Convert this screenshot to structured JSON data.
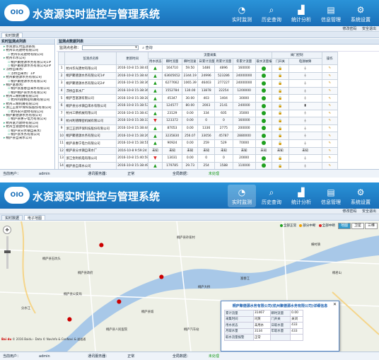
{
  "app": {
    "title": "水资源实时监控与管理系统",
    "logo_text": "OIO",
    "nav": [
      {
        "label": "实时监测",
        "icon": "monitor-icon"
      },
      {
        "label": "历史查询",
        "icon": "search-icon"
      },
      {
        "label": "统计分析",
        "icon": "chart-icon"
      },
      {
        "label": "信息管理",
        "icon": "document-icon"
      },
      {
        "label": "系统设置",
        "icon": "gear-icon"
      }
    ],
    "change_password": "修改密码",
    "logout": "安全退出"
  },
  "panel1": {
    "tabs": [
      "实时数据"
    ],
    "left_title": "实时监测点列表",
    "tree": [
      {
        "level": 1,
        "label": "水资源实时监测系统"
      },
      {
        "level": 1,
        "label": "杭州华光建材有限公司"
      },
      {
        "level": 2,
        "label": "杭州华光建材有限公司"
      },
      {
        "level": 1,
        "label": "杭州市水公司"
      },
      {
        "level": 2,
        "label": "桐庐聚德源水务有限公司1#"
      },
      {
        "level": 2,
        "label": "桐庐聚德源水务有限公司2#"
      },
      {
        "level": 1,
        "label": "浮桥自来水厂"
      },
      {
        "level": 2,
        "label": "浮桥自来水厂1#"
      },
      {
        "level": 1,
        "label": "杭州聚德源水务有限公司"
      },
      {
        "level": 2,
        "label": "桐庐聚德源水务有限公司"
      },
      {
        "level": 1,
        "label": "桐庐富春水厂"
      },
      {
        "level": 2,
        "label": "桐庐县富春自来水有限公司"
      },
      {
        "level": 2,
        "label": "桐庐桐庐县水务有限公司"
      },
      {
        "level": 1,
        "label": "杭州三精机械有限公司"
      },
      {
        "level": 2,
        "label": "杭州利德精密机械有限公司"
      },
      {
        "level": 1,
        "label": "杭州三精机械有限公司"
      },
      {
        "level": 1,
        "label": "浙江正新环保科技股份有限公司"
      },
      {
        "level": 2,
        "label": "杭州永兴建材有限公司"
      },
      {
        "level": 1,
        "label": "桐庐聚德源水务有限公司"
      },
      {
        "level": 2,
        "label": "桐庐县惠宁电力有限公司"
      },
      {
        "level": 1,
        "label": "杭州富力建材有限公司"
      },
      {
        "level": 1,
        "label": "杭州立德建材有限公司"
      },
      {
        "level": 2,
        "label": "桐庐县分水镇自来水厂"
      },
      {
        "level": 2,
        "label": "桐庐县水务有限公司"
      },
      {
        "level": 1,
        "label": "桐庐县自来水公司"
      }
    ],
    "list_title": "监测点数据列表",
    "filter_label": "监测点名称：",
    "query_label": "查询",
    "headers": {
      "seq": "",
      "station": "监测点名称",
      "time": "更新时间",
      "flow_group": "流量采集",
      "device_group": "阀门控制",
      "op": "操作",
      "sub": [
        "用水状态",
        "瞬时流量",
        "瞬时流速",
        "日累计流量",
        "月累计流量",
        "年累计流量",
        "取水流量报警",
        "门开关",
        "电源故障"
      ]
    },
    "rows": [
      {
        "no": "1",
        "name": "杭州华光建材有限公司",
        "time": "2016-10-8 15:38:41",
        "s": "up",
        "a": "164710",
        "b": "59.50",
        "c": "1486",
        "d": "4896",
        "e": "160000",
        "alarm": "green",
        "door": "lock",
        "power": "plug"
      },
      {
        "no": "2",
        "name": "桐庐聚德源水务有限公司1#",
        "time": "2016-10-8 15:38:44",
        "s": "up",
        "a": "63605652",
        "b": "2344.19",
        "c": "24996",
        "d": "523286",
        "e": "24000000",
        "alarm": "green",
        "door": "lock",
        "power": "plug"
      },
      {
        "no": "3",
        "name": "桐庐聚德源水务有限公司2#",
        "time": "2016-10-8 15:38:36",
        "s": "up",
        "a": "6277662",
        "b": "1065.39",
        "c": "46403",
        "d": "277227",
        "e": "24000000",
        "alarm": "green",
        "door": "lock",
        "power": "plug"
      },
      {
        "no": "4",
        "name": "浮桥自来水厂",
        "time": "2016-10-8 15:38:36",
        "s": "up",
        "a": "1552784",
        "b": "130.00",
        "c": "13878",
        "d": "22254",
        "e": "1200000",
        "alarm": "green",
        "door": "lock",
        "power": "plug"
      },
      {
        "no": "5",
        "name": "桐庐百富源有限公司",
        "time": "2016-10-8 15:38:28",
        "s": "up",
        "a": "45347",
        "b": "30.00",
        "c": "403",
        "d": "1404",
        "e": "30000",
        "alarm": "green",
        "door": "lock",
        "power": "plug"
      },
      {
        "no": "6",
        "name": "桐庐县分水镇自来水有限公司",
        "time": "2016-10-8 15:38:53",
        "s": "up",
        "a": "124577",
        "b": "80.00",
        "c": "2003",
        "d": "2141",
        "e": "240000",
        "alarm": "green",
        "door": "lock",
        "power": "battery"
      },
      {
        "no": "7",
        "name": "杭州三精机械有限公司",
        "time": "2016-10-8 15:38:43",
        "s": "up",
        "a": "23129",
        "b": "0.00",
        "c": "334",
        "d": "605",
        "e": "35000",
        "alarm": "green",
        "door": "lock",
        "power": "plug"
      },
      {
        "no": "8",
        "name": "杭州利德精密机械有限公司",
        "time": "2016-10-8 15:38:33",
        "s": "down",
        "a": "123372",
        "b": "0.00",
        "c": "0",
        "d": "0",
        "e": "160000",
        "alarm": "green",
        "door": "lock",
        "power": "plug"
      },
      {
        "no": "9",
        "name": "浙江正新环保科技股份有限公司",
        "time": "2016-10-8 15:38:44",
        "s": "up",
        "a": "87053",
        "b": "0.00",
        "c": "1336",
        "d": "2775",
        "e": "200000",
        "alarm": "green",
        "door": "lock",
        "power": "plug"
      },
      {
        "no": "10",
        "name": "桐庐聚德源水务有限公司",
        "time": "2016-10-8 15:38:26",
        "s": "up",
        "a": "3235830",
        "b": "256.07",
        "c": "33056",
        "d": "45787",
        "e": "2880000",
        "alarm": "green",
        "door": "lock",
        "power": "plug"
      },
      {
        "no": "11",
        "name": "桐庐县惠宁电力有限公司",
        "time": "2016-10-8 15:38:51",
        "s": "up",
        "a": "90924",
        "b": "0.00",
        "c": "259",
        "d": "529",
        "e": "70000",
        "alarm": "green",
        "door": "open",
        "power": "plug"
      },
      {
        "no": "12",
        "name": "桐庐县分水镇自来水厂",
        "time": "2016-10-8 9:59:24",
        "s": "na",
        "a": "未知",
        "b": "未知",
        "c": "未知",
        "d": "未知",
        "e": "未知",
        "alarm": "na",
        "door": "na",
        "power": "na"
      },
      {
        "no": "13",
        "name": "浙江金利机电有限公司",
        "time": "2016-10-8 15:40:59",
        "s": "down",
        "a": "13031",
        "b": "0.00",
        "c": "0",
        "d": "0",
        "e": "20000",
        "alarm": "green",
        "door": "lock",
        "power": "plug"
      },
      {
        "no": "14",
        "name": "桐庐县自来水公司",
        "time": "2016-10-8 15:38:49",
        "s": "up",
        "a": "179785",
        "b": "29.73",
        "c": "254",
        "d": "1588",
        "e": "110000",
        "alarm": "green",
        "door": "lock",
        "power": "plug"
      }
    ],
    "status": {
      "user_label": "当前用户：",
      "user": "admin",
      "comm_label": "通讯服务器：",
      "comm": "正常",
      "db_label": "全局数据：",
      "db": "未处理"
    }
  },
  "panel2": {
    "tabs": [
      "实时数据",
      "电子地图"
    ],
    "map_types": [
      "地图",
      "卫星",
      "三维"
    ],
    "legend": [
      {
        "label": "全部正常",
        "color": "#1fa01f"
      },
      {
        "label": "部分中断",
        "color": "#f0a000"
      },
      {
        "label": "全部中断",
        "color": "#d22"
      }
    ],
    "places": [
      "桐庐县石坑头",
      "桐庐县政府",
      "桐庐县孙家村",
      "横村镇",
      "富春江",
      "桐庐县城",
      "桐庐县人民医院",
      "分水江",
      "桐庐汽车站",
      "桐庐县公安局",
      "桐君山",
      "桐庐大桥"
    ],
    "popup": {
      "title": "桐庐聚德源水务有限公司(杭州聚德源水务有限公司)详细信息",
      "rows": [
        {
          "k1": "累计流量",
          "v1": "31467",
          "k2": "瞬时流量",
          "v2": "0.00"
        },
        {
          "k1": "采集时间",
          "v1": "闪蒸",
          "k2": "门开关",
          "v2": "关闭"
        },
        {
          "k1": "用水状态",
          "v1": "未用水",
          "k2": "日取水量",
          "v2": "433"
        },
        {
          "k1": "月取水量",
          "v1": "3134",
          "k2": "年取水量",
          "v2": "433"
        },
        {
          "k1": "取水流量报警",
          "v1": "正常",
          "k2": "",
          "v2": ""
        }
      ]
    },
    "copyright": "© 2016 Baidu - Data © NavInfo & CenNavi & 道道通",
    "baidu_logo": "Bai du",
    "status": {
      "user_label": "当前用户：",
      "user": "admin",
      "comm_label": "通讯服务器：",
      "comm": "正常",
      "db_label": "全局数据：",
      "db": "未处理"
    }
  }
}
